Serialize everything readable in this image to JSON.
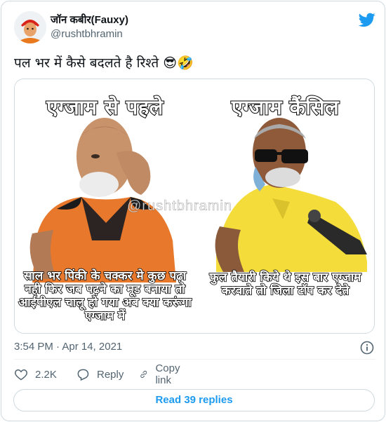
{
  "tweet": {
    "author_name": "जॉन कबीर(Fauxy)",
    "handle": "@rushtbhramin",
    "text": "पल भर में कैसे बदलते है रिश्ते 😎🤣",
    "timestamp": "3:54 PM · Apr 14, 2021"
  },
  "meme": {
    "left_title": "एग्जाम से पहले",
    "left_caption": "साल भर पिंकी के चक्कर मे कुछ पढ़ा नही फिर जब पढ़ने का मूड बनाया तो आईपीएल चालू हो गया अब क्या करूंगा एग्जाम में",
    "right_title": "एग्जाम कैंसिल",
    "right_caption": "फुल तैयारी किये थे इस बार एग्जाम करवाते तो जिला टॉप कर देते",
    "watermark": "@rushtbhramin"
  },
  "actions": {
    "like_count": "2.2K",
    "reply_label": "Reply",
    "copy_link_label": "Copy link",
    "read_replies_label": "Read 39 replies"
  },
  "colors": {
    "accent": "#1d9bf0",
    "secondary_text": "#536471",
    "border": "#cfd9de"
  },
  "icons": {
    "brand": "twitter-bird-icon",
    "info": "info-icon",
    "like": "heart-icon",
    "reply": "reply-bubble-icon",
    "copy_link": "link-icon"
  }
}
